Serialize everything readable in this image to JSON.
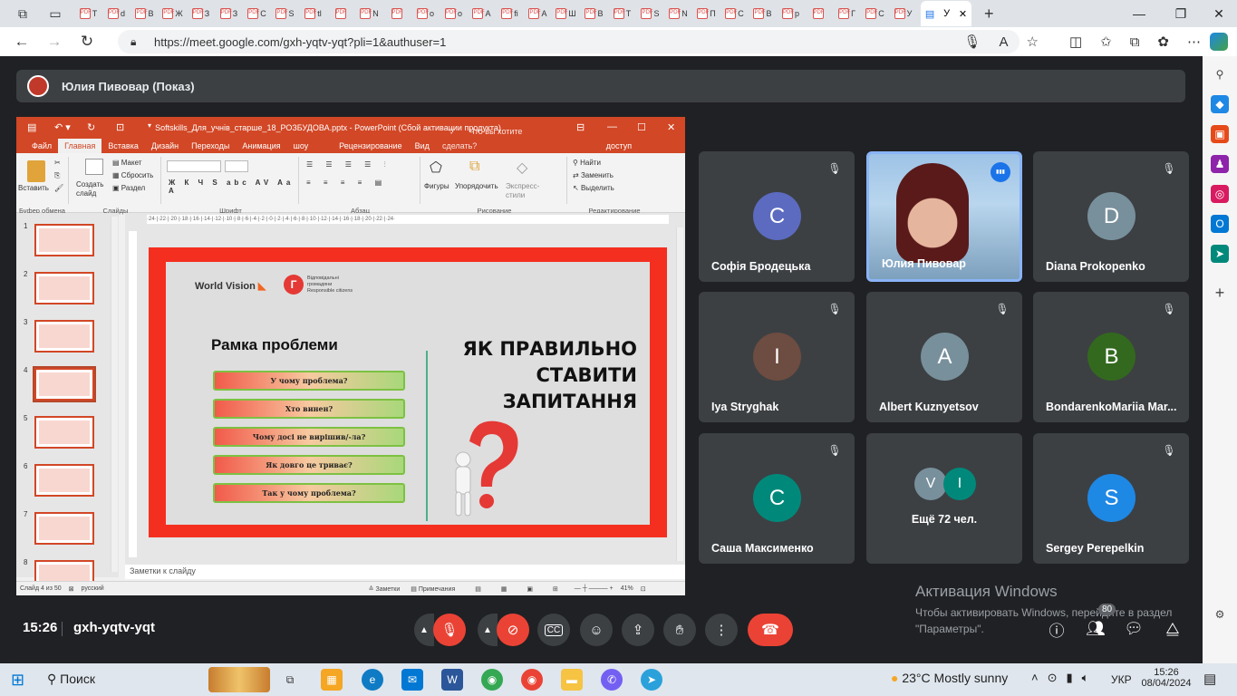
{
  "browser": {
    "url": "https://meet.google.com/gxh-yqtv-yqt?pli=1&authuser=1",
    "tab_letters": [
      "Т",
      "d",
      "В",
      "Ж",
      "З",
      "З",
      "С",
      "S",
      "tl",
      "",
      "N",
      "",
      "о",
      "о",
      "А",
      "fi",
      "А",
      "Ш",
      "В",
      "Т",
      "S",
      "N",
      "П",
      "С",
      "В",
      "р",
      "",
      "Г",
      "С",
      "У"
    ],
    "active_tab_letter": "У"
  },
  "meet": {
    "presenter_name": "Юлия Пивовар (Показ)",
    "time": "15:26",
    "meeting_code": "gxh-yqtv-yqt",
    "people_count": "80",
    "participants": [
      {
        "name": "Софія Бродецька",
        "initial": "С",
        "color": "#5c6bc0"
      },
      {
        "name": "Юлия Пивовар",
        "initial": "",
        "color": "#6d8fae"
      },
      {
        "name": "Diana Prokopenko",
        "initial": "D",
        "color": "#78909c"
      },
      {
        "name": "Iya Stryghak",
        "initial": "I",
        "color": "#6d4c41"
      },
      {
        "name": "Albert Kuznyetsov",
        "initial": "A",
        "color": "#78909c"
      },
      {
        "name": "BondarenkoMariia Mar...",
        "initial": "B",
        "color": "#33691e"
      },
      {
        "name": "Саша Максименко",
        "initial": "C",
        "color": "#00897b"
      },
      {
        "name": "Ещё 72 чел.",
        "initial": "",
        "color": "#3c4043"
      },
      {
        "name": "Sergey Perepelkin",
        "initial": "S",
        "color": "#1e88e5"
      }
    ],
    "more_avatars": [
      "V",
      "I"
    ]
  },
  "ppt": {
    "title": "Softskills_Для_учнів_старше_18_РОЗБУДОВА.pptx - PowerPoint (Сбой активации продукта)",
    "menu": [
      "Файл",
      "Главная",
      "Вставка",
      "Дизайн",
      "Переходы",
      "Анимация",
      "Слайд-шоу",
      "Рецензирование",
      "Вид"
    ],
    "tell_me": "Что вы хотите сделать?",
    "share": "Общий доступ",
    "ribbon": {
      "paste": "Вставить",
      "create_slide": "Создать слайд",
      "layout": "Макет",
      "reset": "Сбросить",
      "section": "Раздел",
      "shapes": "Фигуры",
      "arrange": "Упорядочить",
      "quick_styles": "Экспресс-стили",
      "find": "Найти",
      "replace": "Заменить",
      "select": "Выделить",
      "groups": [
        "Буфер обмена",
        "Слайды",
        "Шрифт",
        "Абзац",
        "Рисование",
        "Редактирование"
      ]
    },
    "ruler": "·24·|·22·|·20·|·18·|·16·|·14·|·12·|·10·|·8·|·6·|·4·|·2·|·0·|·2·|·4·|·6·|·8·|·10·|·12·|·14·|·16·|·18·|·20·|·22·|·24·",
    "thumb_numbers": [
      "1",
      "2",
      "3",
      "4",
      "5",
      "6",
      "7",
      "8"
    ],
    "notes_placeholder": "Заметки к слайду",
    "status_slide": "Слайд 4 из 50",
    "status_lang": "русский",
    "status_notes": "Заметки",
    "status_comments": "Примечания",
    "zoom": "41%",
    "slide": {
      "logo1": "World Vision",
      "logo2_line1": "Відповідальні",
      "logo2_line2": "громадяни",
      "logo2_line3": "Responsible citizens",
      "frame_title": "Рамка проблеми",
      "questions": [
        "У чому проблема?",
        "Хто винен?",
        "Чому досі не вирішив/-ла?",
        "Як довго це триває?",
        "Так у чому проблема?"
      ],
      "headline": [
        "ЯК ПРАВИЛЬНО",
        "СТАВИТИ",
        "ЗАПИТАННЯ"
      ]
    }
  },
  "watermark": {
    "title": "Активация Windows",
    "line1": "Чтобы активировать Windows, перейдите в раздел",
    "line2": "\"Параметры\"."
  },
  "taskbar": {
    "search": "Поиск",
    "weather": "23°C  Mostly sunny",
    "lang": "УКР",
    "time": "15:26",
    "date": "08/04/2024"
  }
}
